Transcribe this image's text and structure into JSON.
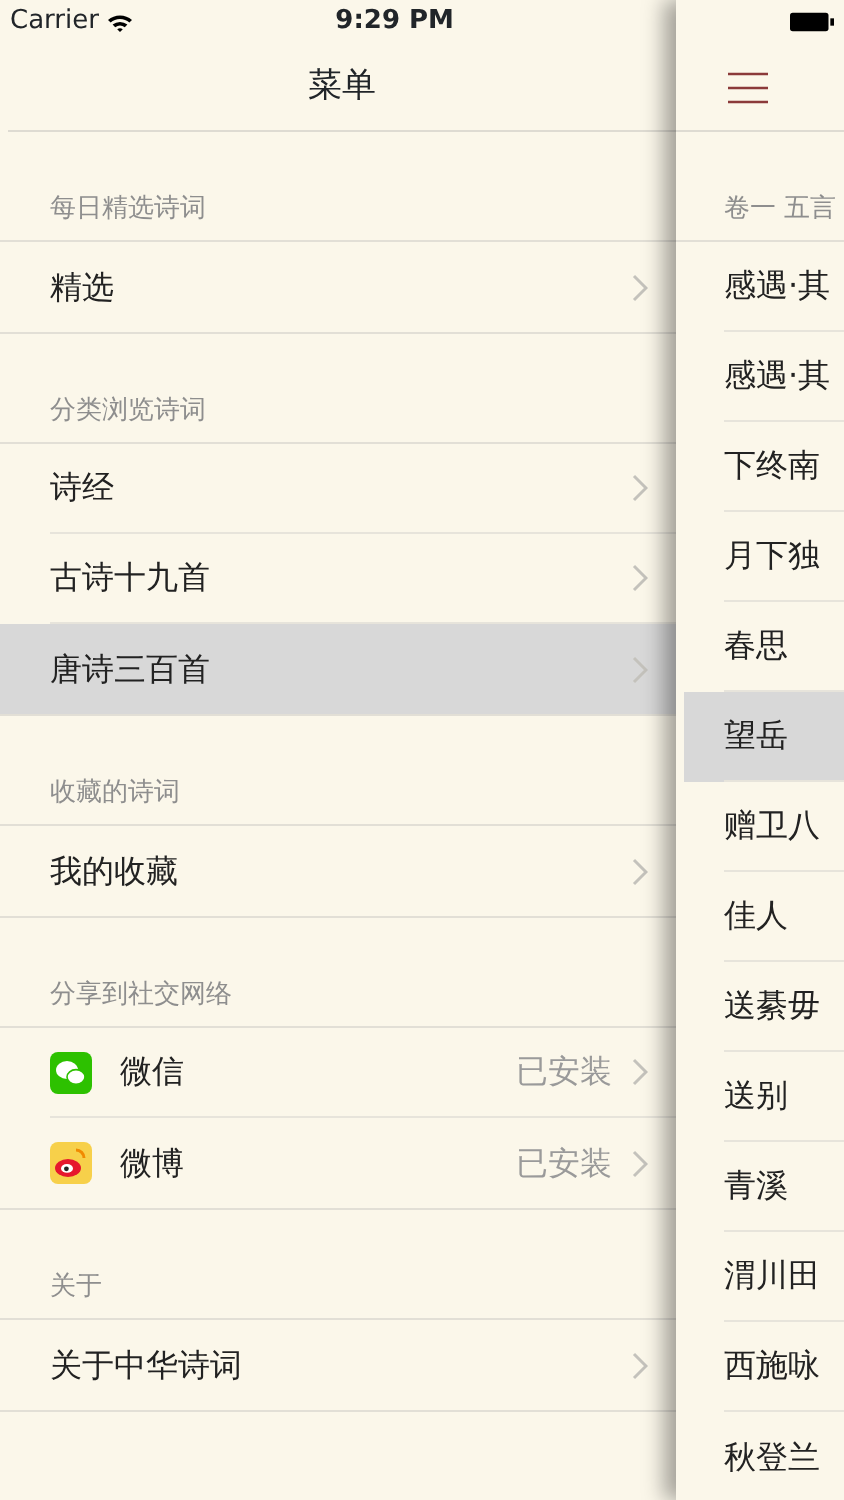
{
  "status_bar": {
    "carrier": "Carrier",
    "time": "9:29 PM"
  },
  "menu": {
    "title": "菜单",
    "sections": [
      {
        "header": "每日精选诗词",
        "items": [
          {
            "label": "精选",
            "selected": false
          }
        ]
      },
      {
        "header": "分类浏览诗词",
        "items": [
          {
            "label": "诗经",
            "selected": false
          },
          {
            "label": "古诗十九首",
            "selected": false
          },
          {
            "label": "唐诗三百首",
            "selected": true
          }
        ]
      },
      {
        "header": "收藏的诗词",
        "items": [
          {
            "label": "我的收藏",
            "selected": false
          }
        ]
      },
      {
        "header": "分享到社交网络",
        "items": [
          {
            "label": "微信",
            "kind": "wechat",
            "detail": "已安装",
            "selected": false
          },
          {
            "label": "微博",
            "kind": "weibo",
            "detail": "已安装",
            "selected": false
          }
        ]
      },
      {
        "header": "关于",
        "items": [
          {
            "label": "关于中华诗词",
            "selected": false
          }
        ]
      }
    ]
  },
  "poem_list": {
    "section": "卷一 五言",
    "items": [
      {
        "title": "感遇·其",
        "selected": false
      },
      {
        "title": "感遇·其",
        "selected": false
      },
      {
        "title": "下终南",
        "selected": false
      },
      {
        "title": "月下独",
        "selected": false
      },
      {
        "title": "春思",
        "selected": false
      },
      {
        "title": "望岳",
        "selected": true
      },
      {
        "title": "赠卫八",
        "selected": false
      },
      {
        "title": "佳人",
        "selected": false
      },
      {
        "title": "送綦毋",
        "selected": false
      },
      {
        "title": "送别",
        "selected": false
      },
      {
        "title": "青溪",
        "selected": false
      },
      {
        "title": "渭川田",
        "selected": false
      },
      {
        "title": "西施咏",
        "selected": false
      },
      {
        "title": "秋登兰",
        "selected": false
      }
    ]
  }
}
